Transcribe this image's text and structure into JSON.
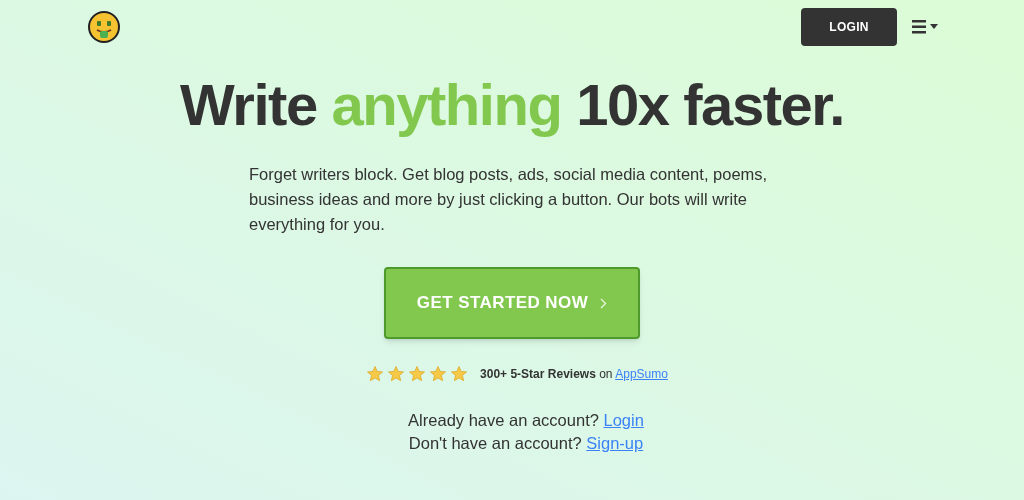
{
  "header": {
    "login_button": "LOGIN"
  },
  "headline": [
    {
      "text": "Write",
      "highlight": false
    },
    {
      "text": "anything",
      "highlight": true
    },
    {
      "text": "10x faster.",
      "highlight": false
    }
  ],
  "intro": "Forget writers block. Get blog posts, ads, social media content, poems, business ideas and more by just clicking a button. Our bots will write everything for you.",
  "cta_button": "GET STARTED NOW",
  "reviews": {
    "stars": 5,
    "label": "300+ 5-Star Reviews",
    "joiner": "on",
    "link": "AppSumo"
  },
  "account_lines": [
    {
      "text": "Already have an account?",
      "link": "Login"
    },
    {
      "text": "Don't have an account?",
      "link": "Sign-up"
    }
  ]
}
